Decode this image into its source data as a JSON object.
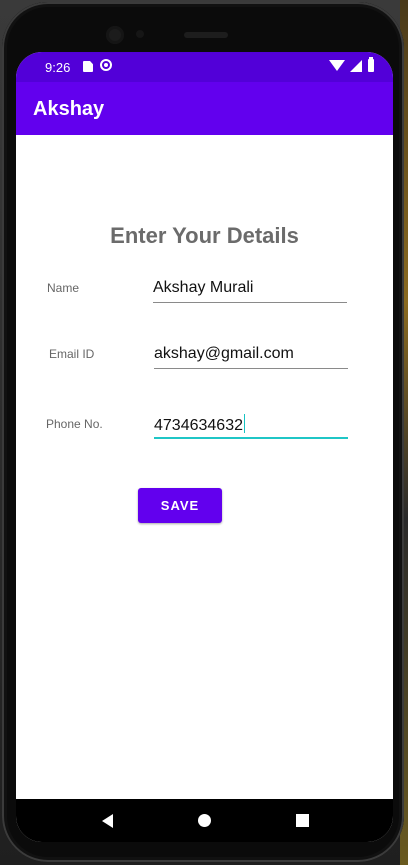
{
  "status_bar": {
    "time": "9:26",
    "icons": [
      "sd-card-icon",
      "sync-icon",
      "wifi-icon",
      "signal-icon",
      "battery-icon"
    ]
  },
  "app_bar": {
    "title": "Akshay"
  },
  "form": {
    "heading": "Enter Your Details",
    "name_label": "Name",
    "name_value": "Akshay Murali",
    "email_label": "Email ID",
    "email_value": "akshay@gmail.com",
    "phone_label": "Phone No.",
    "phone_value": "4734634632"
  },
  "actions": {
    "save_label": "SAVE"
  },
  "colors": {
    "status_bar": "#5200d8",
    "app_bar": "#6200ee",
    "accent": "#1fc6c6",
    "button": "#6200ee"
  }
}
